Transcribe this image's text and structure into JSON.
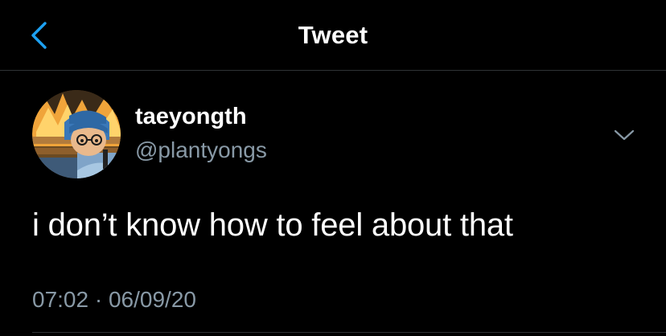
{
  "header": {
    "title": "Tweet",
    "back_icon": "chevron-left-icon"
  },
  "tweet": {
    "author": {
      "display_name": "taeyongth",
      "handle": "@plantyongs"
    },
    "more_icon": "chevron-down-icon",
    "text": "i don’t know how to feel about that",
    "time": "07:02",
    "separator": "·",
    "date": "06/09/20"
  },
  "colors": {
    "background": "#000000",
    "accent": "#1da1f2",
    "text_primary": "#ffffff",
    "text_secondary": "#8899a6",
    "divider": "#2f3336"
  }
}
